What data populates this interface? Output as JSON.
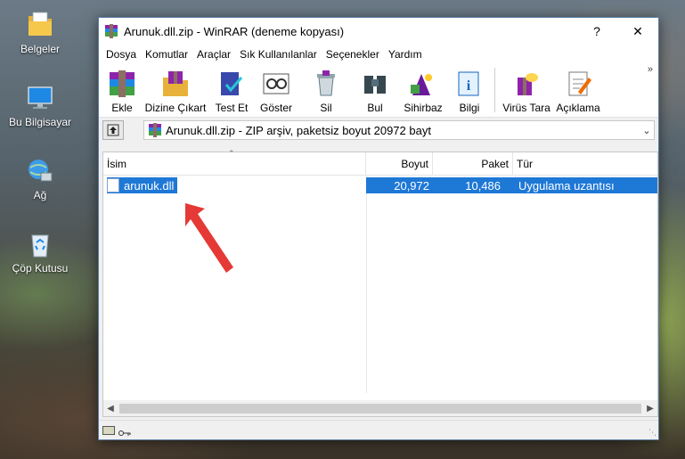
{
  "desktop": {
    "icons": [
      {
        "label": "Belgeler",
        "icon": "folder-icon"
      },
      {
        "label": "Bu Bilgisayar",
        "icon": "computer-icon"
      },
      {
        "label": "Ağ",
        "icon": "network-icon"
      },
      {
        "label": "Çöp Kutusu",
        "icon": "recycle-bin-icon"
      }
    ]
  },
  "window": {
    "title": "Arunuk.dll.zip - WinRAR (deneme kopyası)",
    "help_label": "?",
    "close_label": "✕"
  },
  "menu": [
    "Dosya",
    "Komutlar",
    "Araçlar",
    "Sık Kullanılanlar",
    "Seçenekler",
    "Yardım"
  ],
  "toolbar": {
    "buttons": [
      {
        "label": "Ekle",
        "icon": "add-archive-icon"
      },
      {
        "label": "Dizine Çıkart",
        "icon": "extract-to-icon"
      },
      {
        "label": "Test Et",
        "icon": "test-icon"
      },
      {
        "label": "Göster",
        "icon": "view-icon"
      },
      {
        "label": "Sil",
        "icon": "delete-icon"
      },
      {
        "label": "Bul",
        "icon": "find-icon"
      },
      {
        "label": "Sihirbaz",
        "icon": "wizard-icon"
      },
      {
        "label": "Bilgi",
        "icon": "info-icon"
      },
      {
        "label": "Virüs Tara",
        "icon": "virus-scan-icon"
      },
      {
        "label": "Açıklama",
        "icon": "comment-icon"
      }
    ],
    "more_label": "»"
  },
  "address": {
    "path": "Arunuk.dll.zip - ZIP arşiv, paketsiz boyut 20972 bayt",
    "dropdown_icon": "chevron-down-icon"
  },
  "columns": {
    "name": "İsim",
    "size": "Boyut",
    "packed": "Paket",
    "type": "Tür"
  },
  "files": [
    {
      "name": "arunuk.dll",
      "size": "20,972",
      "packed": "10,486",
      "type": "Uygulama uzantısı",
      "selected": true
    }
  ],
  "colors": {
    "selection": "#1e78d6",
    "annotation_arrow": "#e53935"
  }
}
